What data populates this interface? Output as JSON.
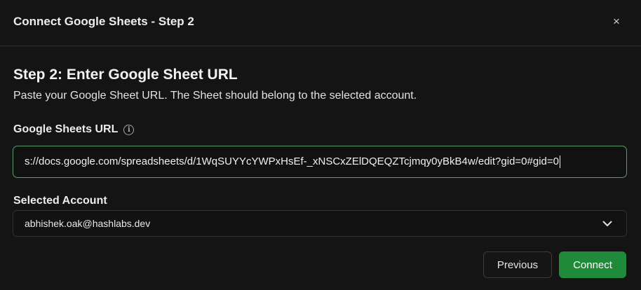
{
  "dialog": {
    "title": "Connect Google Sheets - Step 2",
    "close_label": "×"
  },
  "step": {
    "heading": "Step 2: Enter Google Sheet URL",
    "description": "Paste your Google Sheet URL. The Sheet should belong to the selected account."
  },
  "url_field": {
    "label": "Google Sheets URL",
    "info_icon": "info-icon",
    "value": "s://docs.google.com/spreadsheets/d/1WqSUYYcYWPxHsEf-_xNSCxZElDQEQZTcjmqy0yBkB4w/edit?gid=0#gid=0"
  },
  "account_field": {
    "label": "Selected Account",
    "value": "abhishek.oak@hashlabs.dev",
    "chevron_icon": "chevron-down-icon"
  },
  "buttons": {
    "previous": "Previous",
    "connect": "Connect"
  },
  "colors": {
    "background": "#141414",
    "accent_green": "#1e8a3a",
    "input_focus_border": "#5b9a6a"
  }
}
